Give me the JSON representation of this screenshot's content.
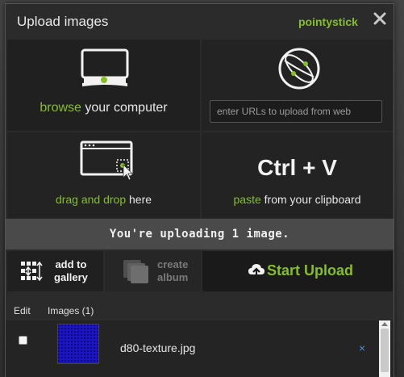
{
  "header": {
    "title": "Upload images",
    "username": "pointystick",
    "close_icon": "close-icon"
  },
  "browse": {
    "accent": "browse",
    "rest": " your computer",
    "icon": "monitor-icon"
  },
  "url": {
    "placeholder": "enter URLs to upload from web",
    "icon": "globe-icon"
  },
  "drag": {
    "accent": "drag and drop",
    "rest": " here",
    "icon": "drag-window-icon"
  },
  "paste": {
    "shortcut": "Ctrl + V",
    "accent": "paste",
    "rest": " from your clipboard"
  },
  "status": "You're uploading 1 image.",
  "actions": {
    "gallery_line1": "add to",
    "gallery_line2": "gallery",
    "album_line1": "create",
    "album_line2": "album",
    "upload": "Start Upload"
  },
  "table": {
    "col_edit": "Edit",
    "col_images": "Images (1)",
    "rows": [
      {
        "filename": "d80-texture.jpg",
        "remove": "×"
      }
    ]
  },
  "colors": {
    "accent": "#85bf25",
    "thumbnail": "#1a12b8",
    "remove": "#4a8fe0"
  }
}
